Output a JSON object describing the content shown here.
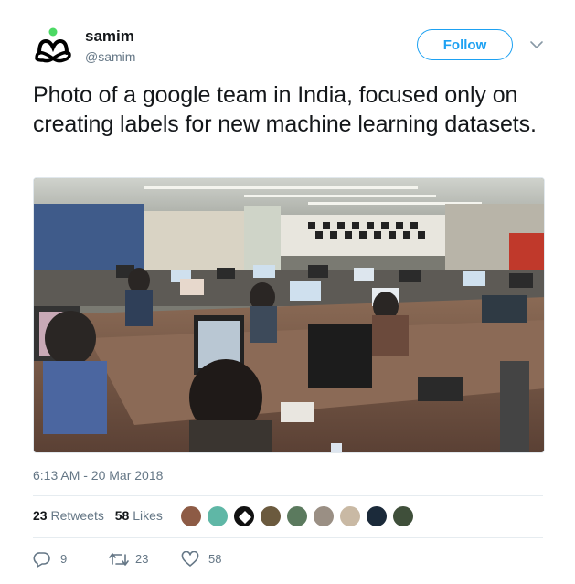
{
  "user": {
    "display_name": "samim",
    "handle": "@samim"
  },
  "follow_label": "Follow",
  "tweet": {
    "text": "Photo of a google team in India, focused only on creating labels for new machine learning datasets.",
    "timestamp": "6:13 AM - 20 Mar 2018"
  },
  "stats": {
    "retweets_count": "23",
    "retweets_label": "Retweets",
    "likes_count": "58",
    "likes_label": "Likes"
  },
  "actions": {
    "reply_count": "9",
    "retweet_count": "23",
    "like_count": "58"
  },
  "colors": {
    "accent": "#1da1f2",
    "logo_green": "#4cd964",
    "secondary_text": "#657786"
  },
  "icons": [
    "meditation-logo-icon",
    "chevron-down-icon",
    "reply-icon",
    "retweet-icon",
    "heart-icon"
  ]
}
